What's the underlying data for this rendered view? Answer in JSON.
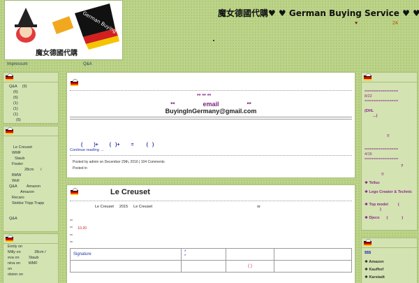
{
  "header": {
    "logo_text": "魔女德國代購",
    "logo_arc_text": "German Buying Service",
    "title": "魔女德國代購♥ ♥ German Buying Service ♥ ♥",
    "meta_heart": "♥",
    "meta_number": "24"
  },
  "nav": {
    "items": [
      "Impressum",
      "Q&A"
    ]
  },
  "left_sidebar": {
    "widget1": [
      {
        "label": "Q&A",
        "count": "(9)"
      },
      {
        "label": "",
        "count": "(6)"
      },
      {
        "label": "",
        "count": "(6)"
      },
      {
        "label": "",
        "count": "(1)"
      },
      {
        "label": "",
        "count": "(1)"
      },
      {
        "label": "",
        "count": "(1)"
      },
      {
        "label": "",
        "count": "(5)"
      }
    ],
    "widget2": [
      "Le Creuset",
      "WMF",
      "Staub",
      "Fissler",
      "28cm",
      "BMW",
      "Woll",
      "Q&A",
      "Amazon",
      "Amazon",
      "Recaro",
      "Stokke Tripp Trapp",
      "Q&A"
    ],
    "widget2_separator": "/",
    "comments": [
      {
        "author": "Emily",
        "on": "on"
      },
      {
        "author": "Milly",
        "on": "on",
        "note": "28cm",
        "sep": "/"
      },
      {
        "author": "eva",
        "on": "on",
        "note": "Staub"
      },
      {
        "author": "nina",
        "on": "on",
        "note": "WMF"
      },
      {
        "author": "",
        "on": "on"
      },
      {
        "author": "olsion",
        "on": "on"
      }
    ]
  },
  "post1": {
    "stars": "**   **   **",
    "email_prefix": "**",
    "email_word": "email",
    "email_suffix": "**",
    "email_address": "BuyingInGermany@gmail.com",
    "formula_a": "(",
    "formula_b": ")+",
    "formula_c": "(",
    "formula_d": ")+",
    "formula_e": "=",
    "formula_f": "(",
    "formula_g": ")",
    "continue": "Continue reading",
    "continue_suffix": "→",
    "posted_by": "Posted by admin on December 29th, 2016 | 104 Comments",
    "posted_in": "Posted in"
  },
  "post2": {
    "title": "Le Creuset",
    "line1_a": "Le Creuset",
    "line1_b": "2015",
    "line1_c": "Le Creuset",
    "line1_d": "or",
    "asterisk1": "**",
    "asterisk2": "**",
    "range": "10-20",
    "asterisk3": "**",
    "asterisk4": "**",
    "table_col1": "Signature",
    "table_mark1": "*",
    "table_mark2": "*",
    "table_paren": "( )"
  },
  "right_sidebar": {
    "lines": [
      "===============",
      "8/22",
      "===============",
      "(DHL",
      "...)",
      "!!",
      "===============",
      "4/16",
      "===============",
      "?",
      "!!"
    ],
    "links": [
      "❖ Telluc",
      "❖ Lego Creator & Technic",
      "❖ Top model",
      "(",
      ")",
      "❖ Djeco",
      "(",
      ")"
    ],
    "widget2_head": "$$$",
    "widget2": [
      "$$$",
      "❖ Amazon",
      "❖ Kaufhof",
      "❖ Karstadt"
    ]
  }
}
